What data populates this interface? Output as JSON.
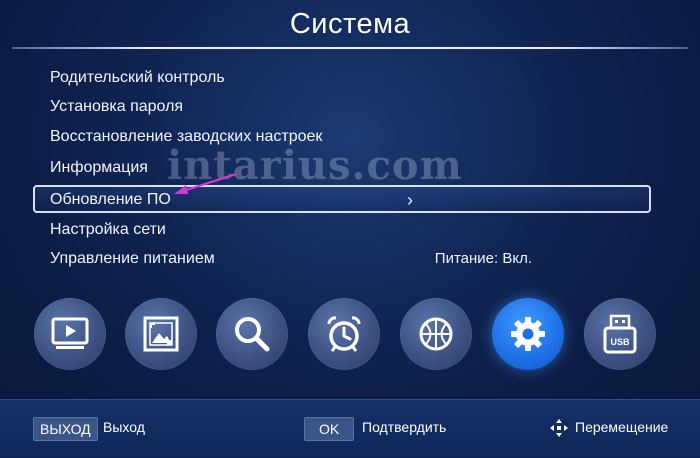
{
  "header": {
    "title": "Система"
  },
  "menu": {
    "items": [
      {
        "label": "Родительский контроль"
      },
      {
        "label": "Установка пароля"
      },
      {
        "label": "Восстановление заводских настроек"
      },
      {
        "label": "Информация"
      },
      {
        "label": "Обновление ПО",
        "chevron": "›"
      },
      {
        "label": "Настройка сети"
      },
      {
        "label": "Управление питанием",
        "value": "Питание: Вкл."
      }
    ],
    "selected_index": 4
  },
  "watermark": "intarius.com",
  "icons": [
    {
      "name": "tv-icon"
    },
    {
      "name": "picture-icon"
    },
    {
      "name": "search-icon"
    },
    {
      "name": "alarm-clock-icon"
    },
    {
      "name": "ball-icon"
    },
    {
      "name": "gear-icon",
      "active": true
    },
    {
      "name": "usb-icon"
    }
  ],
  "footer": {
    "exit_key": "ВЫХОД",
    "exit_label": "Выход",
    "ok_key": "OK",
    "ok_label": "Подтвердить",
    "move_label": "Перемещение"
  },
  "colors": {
    "accent": "#1e6fe6",
    "background": "#0f2350",
    "selection_border": "#d8e0ff"
  }
}
